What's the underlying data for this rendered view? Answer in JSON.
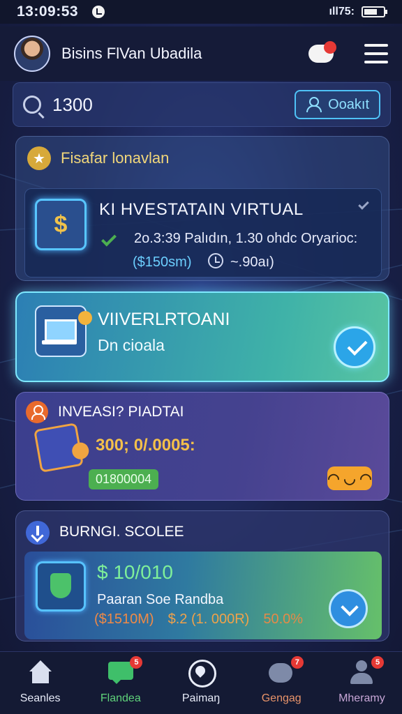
{
  "status_bar": {
    "time": "13:09:53",
    "right_text": "ıll75:"
  },
  "header": {
    "title": "Bisins FlVan Ubadila",
    "chat_badge": ""
  },
  "search": {
    "value": "1300",
    "button_label": "Ooakıt"
  },
  "card1": {
    "title": "Fisafar lonavlan",
    "inner_title": "KI HVESTATAIN VIRTUAL",
    "meta": "2o.3:39 Palıdın, 1.30 ohdc Oryarioc:",
    "amount": "($150sm)",
    "value": "~.90aı)"
  },
  "card2": {
    "title": "VIIVERLRTOANI",
    "subtitle": "Dn cioala"
  },
  "card3": {
    "title": "INVEASI? PIADTAI",
    "amount": "300; 0/.0005:",
    "pill": "01800004",
    "reaction": "◠ ◡ ◠"
  },
  "card4": {
    "title": "BURNGI. SCOLEE",
    "amount": "$ 10/010",
    "subtitle": "Paaran Soe Randba",
    "values": [
      "($1510M)",
      "$.2 (1. 000R)",
      "50.0%"
    ]
  },
  "bottom_nav": [
    {
      "label": "Seanles",
      "color": "#e6eaf7",
      "badge": ""
    },
    {
      "label": "Flandea",
      "color": "#5fd27a",
      "badge": "5"
    },
    {
      "label": "Paimaŋ",
      "color": "#e6eaf7",
      "badge": ""
    },
    {
      "label": "Gengag",
      "color": "#e9946a",
      "badge": "7"
    },
    {
      "label": "Mheramy",
      "color": "#c7a6d6",
      "badge": "5"
    }
  ]
}
